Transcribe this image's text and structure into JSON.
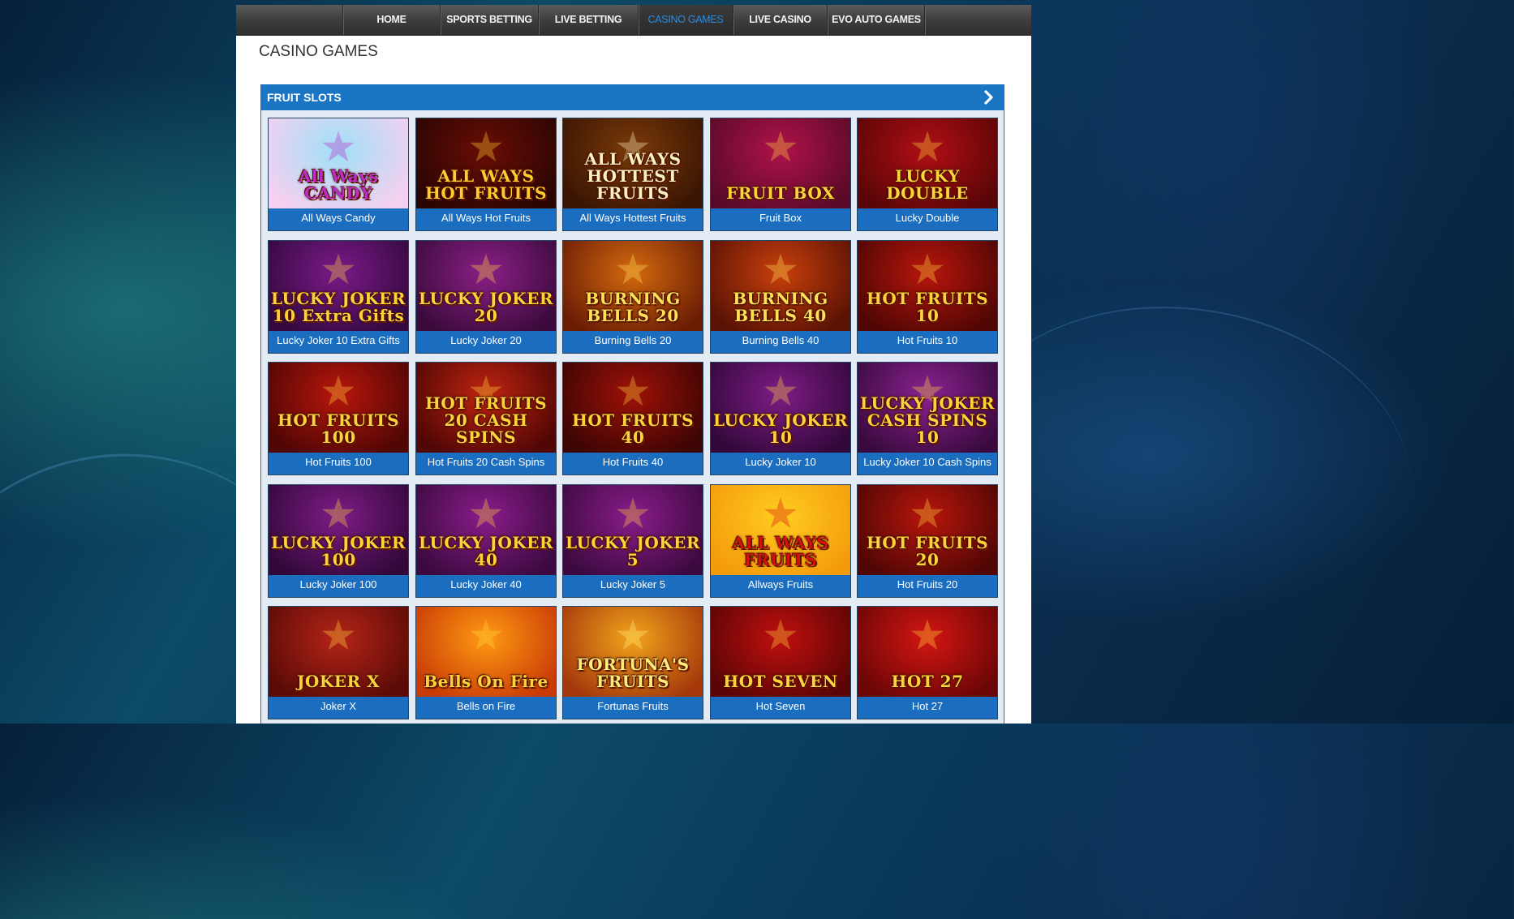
{
  "nav": {
    "items": [
      {
        "label": "HOME",
        "active": false
      },
      {
        "label": "SPORTS BETTING",
        "active": false
      },
      {
        "label": "LIVE BETTING",
        "active": false
      },
      {
        "label": "CASINO GAMES",
        "active": true
      },
      {
        "label": "LIVE CASINO",
        "active": false
      },
      {
        "label": "EVO AUTO GAMES",
        "active": false
      }
    ]
  },
  "page": {
    "title": "CASINO GAMES"
  },
  "section": {
    "title": "FRUIT SLOTS",
    "arrow_icon": "chevron-right-icon"
  },
  "games": [
    {
      "name": "All Ways Candy",
      "thumb": "All Ways CANDY",
      "bg1": "#9fe0f7",
      "bg2": "#f6d0f0",
      "fg": "#c02bc4"
    },
    {
      "name": "All Ways Hot Fruits",
      "thumb": "ALL WAYS HOT FRUITS",
      "bg1": "#6a0d05",
      "bg2": "#2a0502",
      "fg": "#ffcb2e"
    },
    {
      "name": "All Ways Hottest Fruits",
      "thumb": "ALL WAYS HOTTEST FRUITS",
      "bg1": "#7a3a08",
      "bg2": "#3a1503",
      "fg": "#fff0c0"
    },
    {
      "name": "Fruit Box",
      "thumb": "FRUIT BOX",
      "bg1": "#b0124a",
      "bg2": "#5a0a28",
      "fg": "#ffd23b"
    },
    {
      "name": "Lucky Double",
      "thumb": "LUCKY DOUBLE",
      "bg1": "#b10f14",
      "bg2": "#5a0507",
      "fg": "#ffd33a"
    },
    {
      "name": "Lucky Joker 10 Extra Gifts",
      "thumb": "LUCKY JOKER 10 Extra Gifts",
      "bg1": "#7a1a88",
      "bg2": "#34093f",
      "fg": "#ffd23b"
    },
    {
      "name": "Lucky Joker 20",
      "thumb": "LUCKY JOKER 20",
      "bg1": "#8b1f87",
      "bg2": "#3b0b3c",
      "fg": "#ffd23b"
    },
    {
      "name": "Burning Bells 20",
      "thumb": "BURNING BELLS 20",
      "bg1": "#d46a0f",
      "bg2": "#6b1d04",
      "fg": "#ffe056"
    },
    {
      "name": "Burning Bells 40",
      "thumb": "BURNING BELLS 40",
      "bg1": "#c9400c",
      "bg2": "#5a1204",
      "fg": "#ffe056"
    },
    {
      "name": "Hot Fruits 10",
      "thumb": "HOT FRUITS 10",
      "bg1": "#b8160c",
      "bg2": "#4f0604",
      "fg": "#ffd23b"
    },
    {
      "name": "Hot Fruits 100",
      "thumb": "HOT FRUITS 100",
      "bg1": "#b8160c",
      "bg2": "#4f0604",
      "fg": "#ffd23b"
    },
    {
      "name": "Hot Fruits 20 Cash Spins",
      "thumb": "HOT FRUITS 20 CASH SPINS",
      "bg1": "#c02410",
      "bg2": "#4f0604",
      "fg": "#ffd23b"
    },
    {
      "name": "Hot Fruits 40",
      "thumb": "HOT FRUITS 40",
      "bg1": "#9f1208",
      "bg2": "#3c0403",
      "fg": "#ffd23b"
    },
    {
      "name": "Lucky Joker 10",
      "thumb": "LUCKY JOKER 10",
      "bg1": "#7e1c86",
      "bg2": "#32083a",
      "fg": "#ffd23b"
    },
    {
      "name": "Lucky Joker 10 Cash Spins",
      "thumb": "LUCKY JOKER CASH SPINS 10",
      "bg1": "#8a2290",
      "bg2": "#3a0a3f",
      "fg": "#ffd23b"
    },
    {
      "name": "Lucky Joker 100",
      "thumb": "LUCKY JOKER 100",
      "bg1": "#7e1c86",
      "bg2": "#32083a",
      "fg": "#ffd23b"
    },
    {
      "name": "Lucky Joker 40",
      "thumb": "LUCKY JOKER 40",
      "bg1": "#8a1c8a",
      "bg2": "#3c0a40",
      "fg": "#ffd23b"
    },
    {
      "name": "Lucky Joker 5",
      "thumb": "LUCKY JOKER 5",
      "bg1": "#8a1c8a",
      "bg2": "#3c0a40",
      "fg": "#ffd23b"
    },
    {
      "name": "Allways Fruits",
      "thumb": "ALL WAYS FRUITS",
      "bg1": "#ffcc1f",
      "bg2": "#f49b0b",
      "fg": "#d4100e"
    },
    {
      "name": "Hot Fruits 20",
      "thumb": "HOT FRUITS 20",
      "bg1": "#b8160c",
      "bg2": "#4f0604",
      "fg": "#ffd23b"
    },
    {
      "name": "Joker X",
      "thumb": "JOKER X",
      "bg1": "#b52418",
      "bg2": "#5a0b06",
      "fg": "#ffd23b"
    },
    {
      "name": "Bells on Fire",
      "thumb": "Bells On Fire",
      "bg1": "#ff9a12",
      "bg2": "#c83a06",
      "fg": "#ffd23b"
    },
    {
      "name": "Fortunas Fruits",
      "thumb": "FORTUNA'S FRUITS",
      "bg1": "#f2a51c",
      "bg2": "#a4380b",
      "fg": "#ffeb7a"
    },
    {
      "name": "Hot Seven",
      "thumb": "HOT SEVEN",
      "bg1": "#c0100e",
      "bg2": "#5a0505",
      "fg": "#ffd23b"
    },
    {
      "name": "Hot 27",
      "thumb": "HOT 27",
      "bg1": "#d41612",
      "bg2": "#6a0606",
      "fg": "#ffd23b"
    }
  ]
}
